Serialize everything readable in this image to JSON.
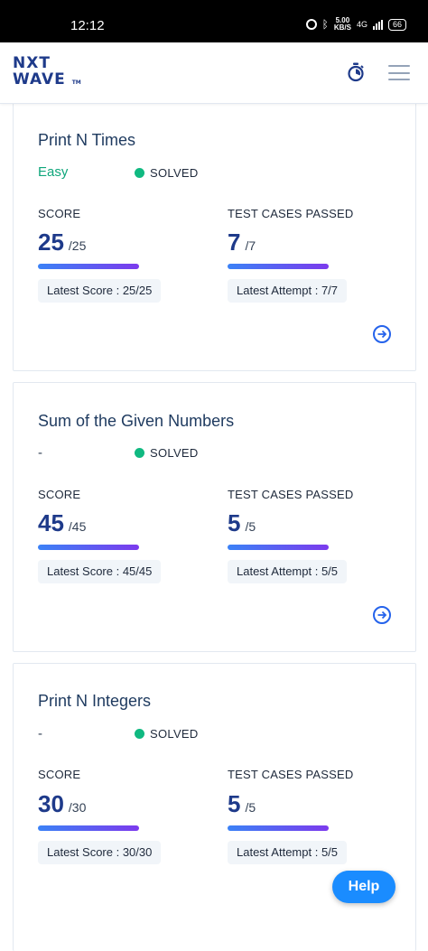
{
  "status_bar": {
    "time": "12:12",
    "speed": "5.00",
    "speed_unit": "KB/S",
    "network": "4G",
    "battery": "66"
  },
  "header": {
    "logo_line1": "NXT",
    "logo_line2": "WAVE",
    "logo_tm": "TM",
    "timer_icon": "stopwatch-icon",
    "menu_icon": "hamburger-icon"
  },
  "cards": [
    {
      "title": "Print N Times",
      "difficulty": "Easy",
      "status": "SOLVED",
      "score_label": "SCORE",
      "score": "25",
      "score_total": "/25",
      "score_progress": 1.0,
      "tests_label": "TEST CASES PASSED",
      "tests": "7",
      "tests_total": "/7",
      "tests_progress": 1.0,
      "latest_score": "Latest Score : 25/25",
      "latest_attempt": "Latest Attempt : 7/7"
    },
    {
      "title": "Sum of the Given Numbers",
      "difficulty": "-",
      "status": "SOLVED",
      "score_label": "SCORE",
      "score": "45",
      "score_total": "/45",
      "score_progress": 1.0,
      "tests_label": "TEST CASES PASSED",
      "tests": "5",
      "tests_total": "/5",
      "tests_progress": 1.0,
      "latest_score": "Latest Score : 45/45",
      "latest_attempt": "Latest Attempt : 5/5"
    },
    {
      "title": "Print N Integers",
      "difficulty": "-",
      "status": "SOLVED",
      "score_label": "SCORE",
      "score": "30",
      "score_total": "/30",
      "score_progress": 1.0,
      "tests_label": "TEST CASES PASSED",
      "tests": "5",
      "tests_total": "/5",
      "tests_progress": 1.0,
      "latest_score": "Latest Score : 30/30",
      "latest_attempt": "Latest Attempt : 5/5"
    }
  ],
  "help_button": "Help",
  "colors": {
    "brand": "#1e3a8a",
    "easy": "#0fa67b",
    "solved_dot": "#10b981",
    "help": "#1a8cff",
    "bar_start": "#3b82f6",
    "bar_end": "#7c3aed"
  }
}
